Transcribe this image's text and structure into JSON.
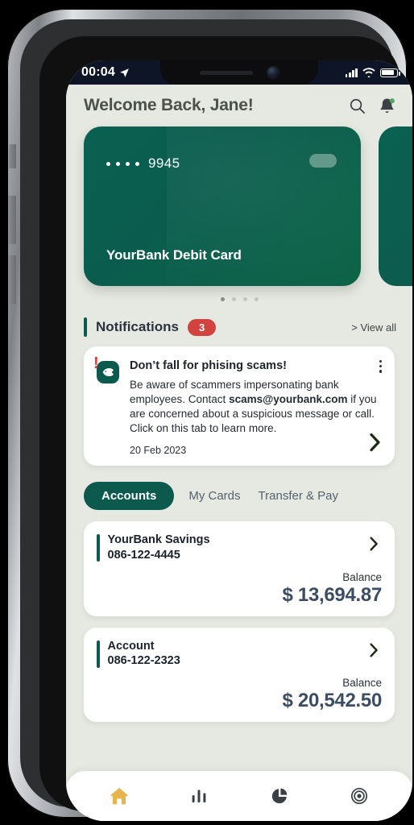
{
  "status_bar": {
    "time": "00:04",
    "location_icon": "location-arrow-icon",
    "signal_icon": "cellular-signal-icon",
    "wifi_icon": "wifi-icon",
    "battery_icon": "battery-icon"
  },
  "header": {
    "title": "Welcome Back, Jane!",
    "search_icon": "search-icon",
    "bell_icon": "notification-bell-icon",
    "bell_has_badge": true,
    "bell_badge_color": "#4fa85f"
  },
  "card": {
    "masked_digits": "• • • •",
    "last_four": "9945",
    "name": "YourBank Debit Card",
    "gradient_from": "#0a6051",
    "gradient_to": "#0c6345",
    "chip_icon": "contactless-chip-icon",
    "carousel_dots": 4,
    "carousel_active_index": 0
  },
  "notifications": {
    "section_title": "Notifications",
    "badge_count": "3",
    "badge_color": "#d2423f",
    "view_all": "> View all",
    "item": {
      "icon": "phishing-fish-icon",
      "alert_glyph": "!",
      "title": "Don’t fall for phising scams!",
      "body_part1": "Be aware of scammers impersonating bank employees. Contact ",
      "body_email": "scams@yourbank.com",
      "body_part2": " if you are concerned about a suspicious message or call. Click on this tab to learn more.",
      "date": "20 Feb 2023",
      "menu_icon": "kebab-menu-icon",
      "chevron_icon": "chevron-right-icon"
    }
  },
  "tabs": [
    {
      "label": "Accounts",
      "active": true
    },
    {
      "label": "My Cards",
      "active": false
    },
    {
      "label": "Transfer & Pay",
      "active": false
    }
  ],
  "accounts": [
    {
      "name": "YourBank Savings",
      "number": "086-122-4445",
      "balance_label": "Balance",
      "balance": "$ 13,694.87",
      "chevron_icon": "chevron-right-icon"
    },
    {
      "name": "Account",
      "number": "086-122-2323",
      "balance_label": "Balance",
      "balance": "$ 20,542.50",
      "chevron_icon": "chevron-right-icon"
    }
  ],
  "bottom_nav": [
    {
      "icon": "home-icon",
      "active": true,
      "color": "#e8b44d"
    },
    {
      "icon": "bar-chart-icon",
      "active": false,
      "color": "#3b4046"
    },
    {
      "icon": "pie-chart-icon",
      "active": false,
      "color": "#3b4046"
    },
    {
      "icon": "target-icon",
      "active": false,
      "color": "#3b4046"
    }
  ],
  "theme": {
    "app_background": "#e6e9e1",
    "brand_green": "#0c5a4e",
    "accent_amber": "#e8b44d",
    "amount_color": "#3c4d63"
  }
}
